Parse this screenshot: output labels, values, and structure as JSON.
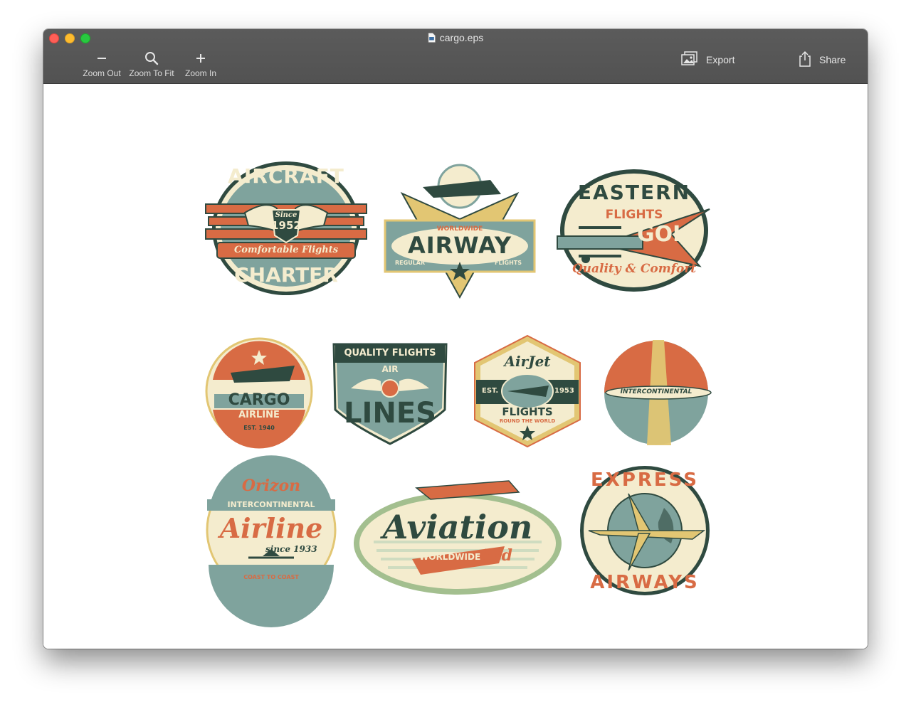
{
  "window": {
    "title": "cargo.eps",
    "toolbar": {
      "zoom_out_label": "Zoom Out",
      "zoom_fit_label": "Zoom To Fit",
      "zoom_in_label": "Zoom In",
      "export_label": "Export",
      "share_label": "Share"
    }
  },
  "icons": {
    "zoom_out": "minus-icon",
    "zoom_fit": "magnifier-icon",
    "zoom_in": "plus-icon",
    "export": "export-photo-icon",
    "share": "share-icon",
    "document": "eps-document-icon"
  },
  "colors": {
    "teal": "#7fa39d",
    "dark_green": "#2f4a40",
    "orange": "#d86b44",
    "cream": "#f4ecce",
    "gold": "#e2c673"
  },
  "badges": {
    "aircraft": {
      "top": "AIRCRAFT",
      "since": "Since",
      "year": "1952",
      "script": "Comfortable Flights",
      "bottom": "CHARTER"
    },
    "airway": {
      "sub": "WORLDWIDE",
      "main": "AIRWAY",
      "left": "REGULAR",
      "right": "FLIGHTS"
    },
    "eastern": {
      "top": "EASTERN",
      "mid": "FLIGHTS",
      "pennant": "GOLD",
      "script": "Quality & Comfort"
    },
    "cargo": {
      "main": "CARGO",
      "sub": "AIRLINE",
      "est": "EST. 1940"
    },
    "airlines": {
      "top": "QUALITY FLIGHTS",
      "air": "AIR",
      "lines": "LINES"
    },
    "airjet": {
      "script": "AirJet",
      "est": "EST.",
      "year": "1953",
      "main": "FLIGHTS",
      "sub": "ROUND THE WORLD"
    },
    "intercontinental": {
      "label": "INTERCONTINENTAL"
    },
    "orizon": {
      "script": "Orizon",
      "sub": "INTERCONTINENTAL",
      "main": "Airline",
      "since": "since 1933",
      "bottom": "COAST TO COAST"
    },
    "aviation": {
      "main": "Aviation",
      "sub": "WORLDWIDE",
      "ltd": "Ltd"
    },
    "express": {
      "top": "EXPRESS",
      "bottom": "AIRWAYS"
    }
  }
}
